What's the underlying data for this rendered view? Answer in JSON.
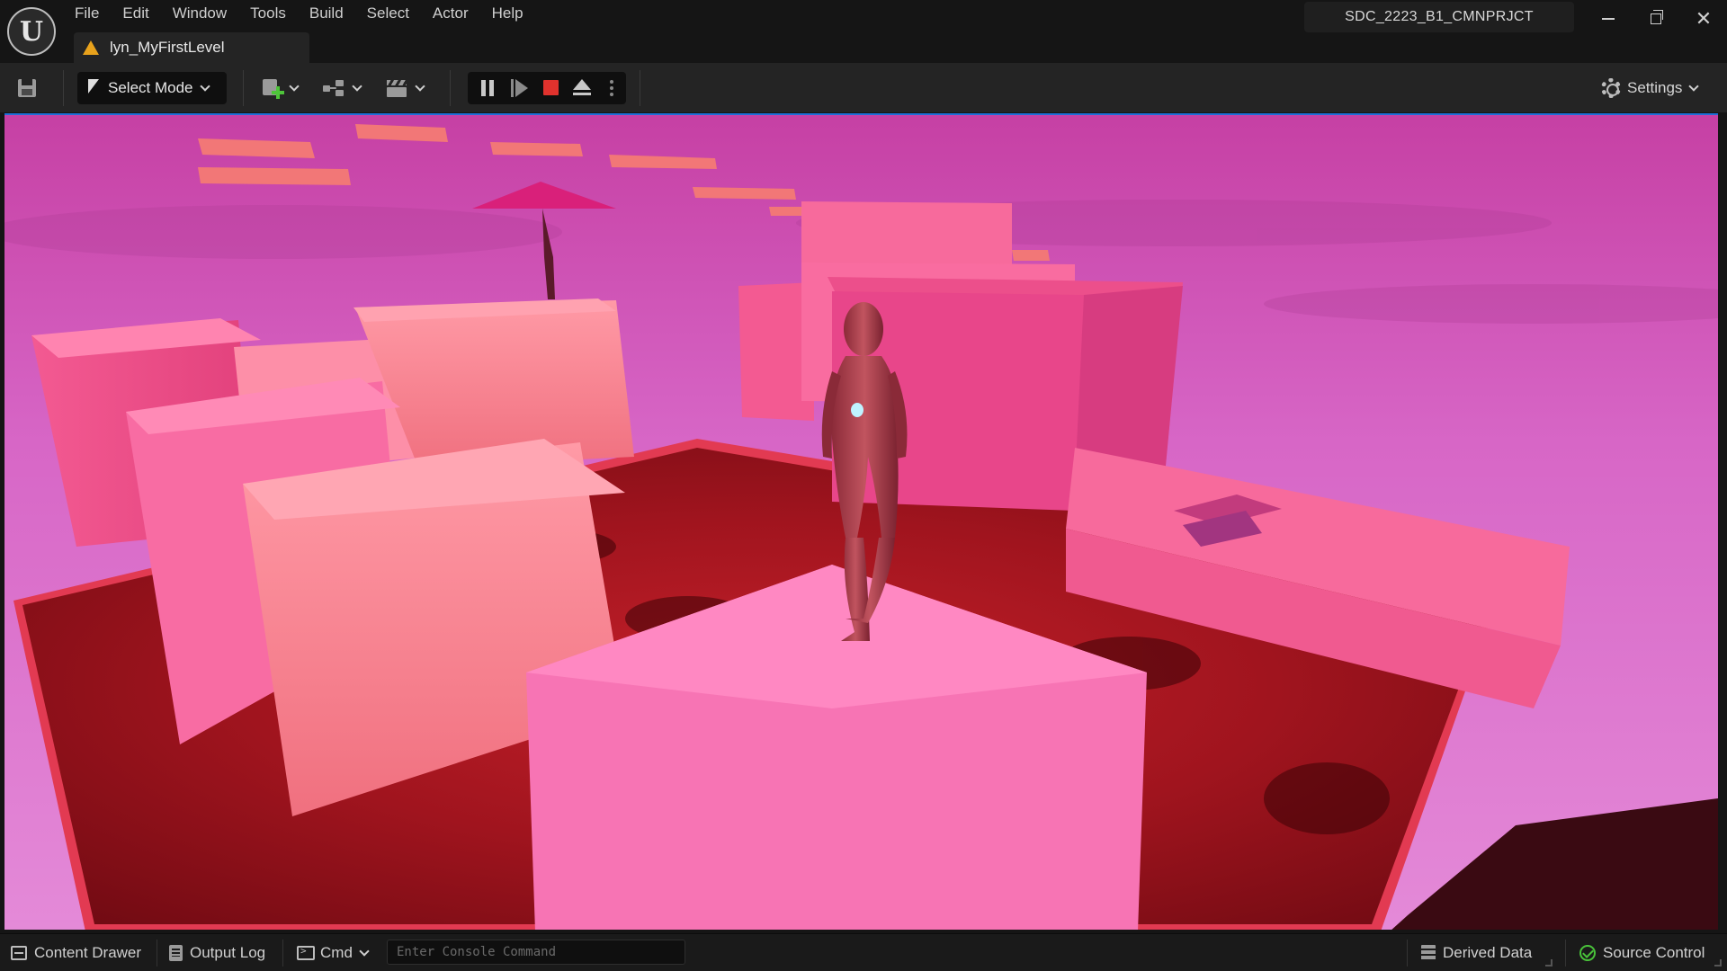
{
  "app": {
    "logo_letter": "U",
    "menu": [
      "File",
      "Edit",
      "Window",
      "Tools",
      "Build",
      "Select",
      "Actor",
      "Help"
    ],
    "level_tab": "lyn_MyFirstLevel",
    "project_name": "SDC_2223_B1_CMNPRJCT"
  },
  "toolbar": {
    "select_mode_label": "Select Mode",
    "settings_label": "Settings"
  },
  "statusbar": {
    "content_drawer": "Content Drawer",
    "output_log": "Output Log",
    "cmd_label": "Cmd",
    "console_placeholder": "Enter Console Command",
    "derived_data": "Derived Data",
    "source_control": "Source Control"
  },
  "colors": {
    "accent_blue": "#1f6fd6",
    "stop_red": "#e0322d",
    "ok_green": "#49c23a",
    "warning_orange": "#e8a21c"
  },
  "viewport": {
    "scene": "pink blocks over red lava with mannequin"
  }
}
